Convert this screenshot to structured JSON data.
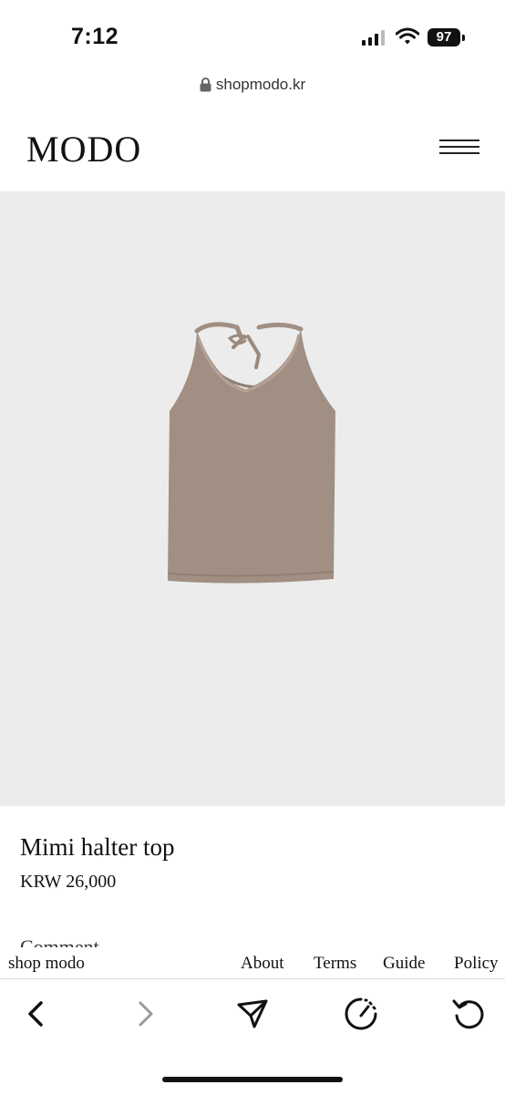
{
  "status_bar": {
    "time": "7:12",
    "battery": "97"
  },
  "browser": {
    "url": "shopmodo.kr"
  },
  "header": {
    "logo": "MODO",
    "menu_icon": "hamburger-menu-icon"
  },
  "product": {
    "image_icon": "halter-top-photo",
    "name": "Mimi halter top",
    "price": "KRW 26,000",
    "section_partial": "Comment"
  },
  "footer": {
    "brand": "shop modo",
    "links": [
      "About",
      "Terms",
      "Guide",
      "Policy"
    ]
  },
  "toolbar": {
    "icons": [
      "back-icon",
      "forward-icon",
      "share-icon",
      "speed-icon",
      "reload-icon"
    ]
  },
  "colors": {
    "image_bg": "#ececec",
    "garment": "#a08f82"
  }
}
